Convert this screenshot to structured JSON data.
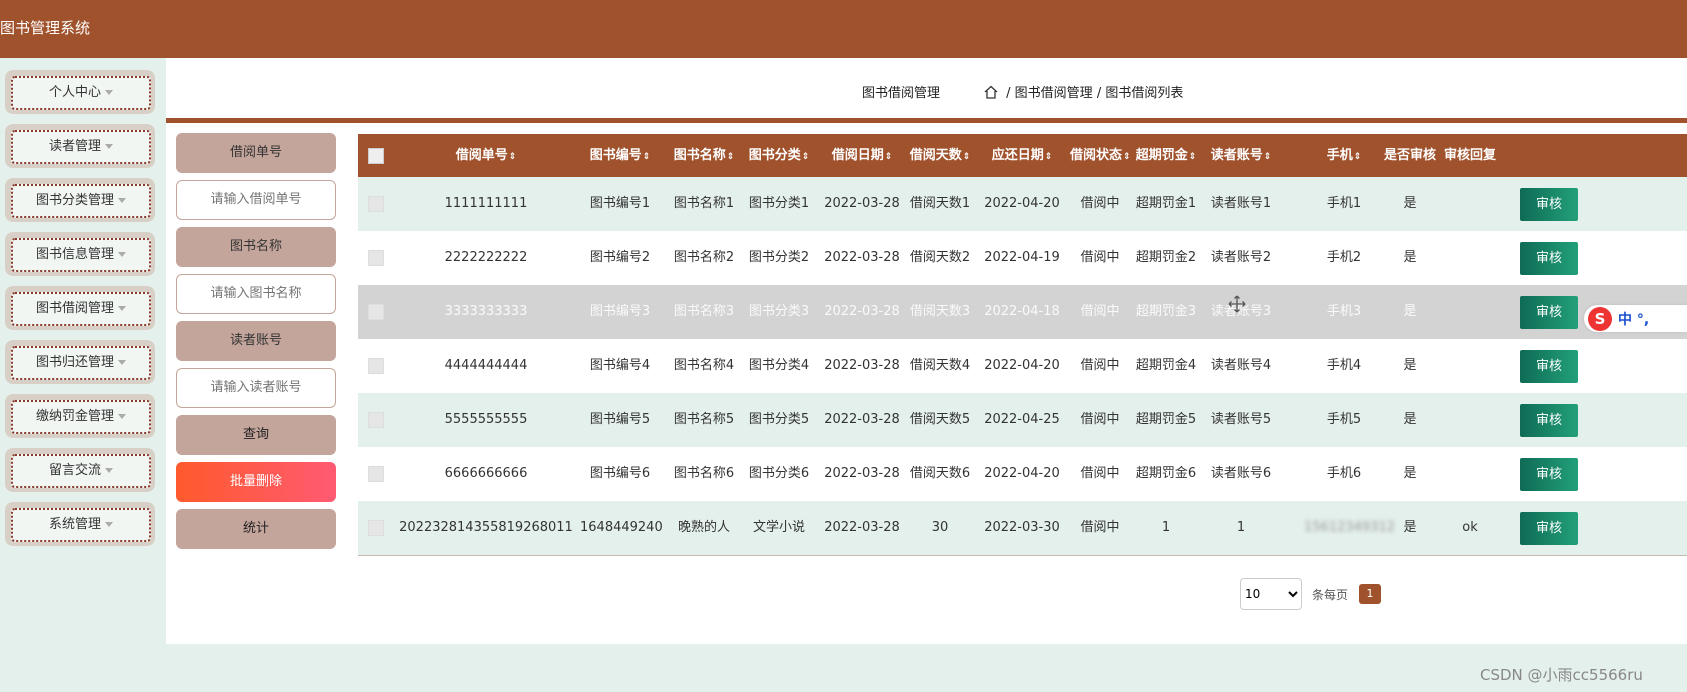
{
  "app": {
    "title": "图书管理系统"
  },
  "sidebar": {
    "items": [
      {
        "label": "个人中心"
      },
      {
        "label": "读者管理"
      },
      {
        "label": "图书分类管理"
      },
      {
        "label": "图书信息管理"
      },
      {
        "label": "图书借阅管理"
      },
      {
        "label": "图书归还管理"
      },
      {
        "label": "缴纳罚金管理"
      },
      {
        "label": "留言交流"
      },
      {
        "label": "系统管理"
      }
    ]
  },
  "header": {
    "page_title": "图书借阅管理",
    "breadcrumb": [
      "图书借阅管理",
      "图书借阅列表"
    ]
  },
  "filters": {
    "borrow_no_label": "借阅单号",
    "borrow_no_placeholder": "请输入借阅单号",
    "book_name_label": "图书名称",
    "book_name_placeholder": "请输入图书名称",
    "reader_label": "读者账号",
    "reader_placeholder": "请输入读者账号",
    "query_button": "查询",
    "batch_delete_button": "批量删除",
    "stats_button": "统计"
  },
  "table": {
    "columns": [
      "借阅单号",
      "图书编号",
      "图书名称",
      "图书分类",
      "借阅日期",
      "借阅天数",
      "应还日期",
      "借阅状态",
      "超期罚金",
      "读者账号",
      "手机",
      "是否审核",
      "审核回复"
    ],
    "sort_glyph": "⇕",
    "action_label": "审核",
    "rows": [
      [
        "1111111111",
        "图书编号1",
        "图书名称1",
        "图书分类1",
        "2022-03-28",
        "借阅天数1",
        "2022-04-20",
        "借阅中",
        "超期罚金1",
        "读者账号1",
        "手机1",
        "是",
        ""
      ],
      [
        "2222222222",
        "图书编号2",
        "图书名称2",
        "图书分类2",
        "2022-03-28",
        "借阅天数2",
        "2022-04-19",
        "借阅中",
        "超期罚金2",
        "读者账号2",
        "手机2",
        "是",
        ""
      ],
      [
        "3333333333",
        "图书编号3",
        "图书名称3",
        "图书分类3",
        "2022-03-28",
        "借阅天数3",
        "2022-04-18",
        "借阅中",
        "超期罚金3",
        "读者账号3",
        "手机3",
        "是",
        ""
      ],
      [
        "4444444444",
        "图书编号4",
        "图书名称4",
        "图书分类4",
        "2022-03-28",
        "借阅天数4",
        "2022-04-20",
        "借阅中",
        "超期罚金4",
        "读者账号4",
        "手机4",
        "是",
        ""
      ],
      [
        "5555555555",
        "图书编号5",
        "图书名称5",
        "图书分类5",
        "2022-03-28",
        "借阅天数5",
        "2022-04-25",
        "借阅中",
        "超期罚金5",
        "读者账号5",
        "手机5",
        "是",
        ""
      ],
      [
        "6666666666",
        "图书编号6",
        "图书名称6",
        "图书分类6",
        "2022-03-28",
        "借阅天数6",
        "2022-04-20",
        "借阅中",
        "超期罚金6",
        "读者账号6",
        "手机6",
        "是",
        ""
      ],
      [
        "20223281435581926801​1",
        "1648449240",
        "晚熟的人",
        "文学小说",
        "2022-03-28",
        "30",
        "2022-03-30",
        "借阅中",
        "1",
        "1",
        "15612349312",
        "是",
        "ok"
      ]
    ]
  },
  "pager": {
    "page_size": "10",
    "per_page_label": "条每页",
    "current_page": "1"
  },
  "ime": {
    "logo": "S",
    "text": "中 °,"
  },
  "watermark": "CSDN @小雨cc5566ru",
  "colors": {
    "brand": "#a0522d",
    "row_alt": "#e4f0ec",
    "hover_row": "#d3d3d3",
    "audit_btn": "#1a8a68",
    "delete_btn": "#ff5a4c"
  }
}
